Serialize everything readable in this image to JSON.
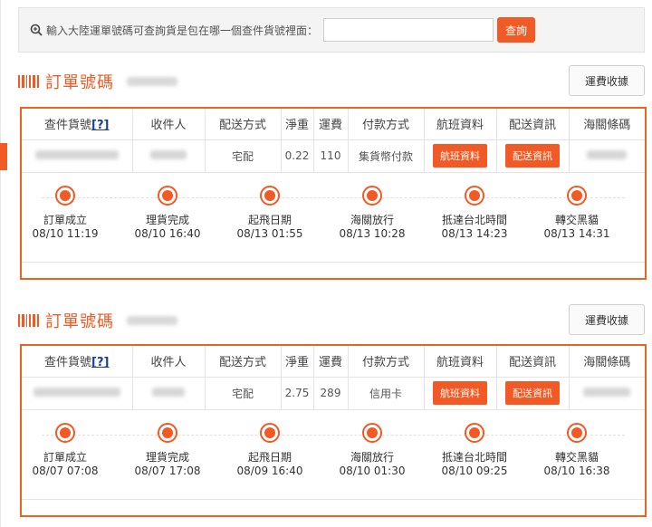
{
  "search": {
    "prompt": "輸入大陸運單號碼可查詢貨是包在哪一個查件貨號裡面：",
    "value": "",
    "placeholder": "",
    "button_label": "查詢"
  },
  "columns": [
    "查件貨號",
    "收件人",
    "配送方式",
    "淨重",
    "運費",
    "付款方式",
    "航班資料",
    "配送資訊",
    "海關條碼"
  ],
  "help_mark": "[?]",
  "orders": [
    {
      "title": "訂單號碼",
      "shipping_button": "運費收據",
      "row": {
        "delivery": "宅配",
        "weight": "0.22",
        "fee": "110",
        "payment": "集貨幣付款",
        "flight_btn": "航班資料",
        "delivery_btn": "配送資訊"
      },
      "timeline": [
        {
          "label": "訂單成立",
          "time": "08/10 11:19"
        },
        {
          "label": "理貨完成",
          "time": "08/10 16:40"
        },
        {
          "label": "起飛日期",
          "time": "08/13 01:55"
        },
        {
          "label": "海關放行",
          "time": "08/13 10:28"
        },
        {
          "label": "抵達台北時間",
          "time": "08/13 14:23"
        },
        {
          "label": "轉交黑貓",
          "time": "08/13 14:31"
        }
      ]
    },
    {
      "title": "訂單號碼",
      "shipping_button": "運費收據",
      "row": {
        "delivery": "宅配",
        "weight": "2.75",
        "fee": "289",
        "payment": "信用卡",
        "flight_btn": "航班資料",
        "delivery_btn": "配送資訊"
      },
      "timeline": [
        {
          "label": "訂單成立",
          "time": "08/07 07:08"
        },
        {
          "label": "理貨完成",
          "time": "08/07 17:08"
        },
        {
          "label": "起飛日期",
          "time": "08/09 16:40"
        },
        {
          "label": "海關放行",
          "time": "08/10 01:30"
        },
        {
          "label": "抵達台北時間",
          "time": "08/10 09:25"
        },
        {
          "label": "轉交黑貓",
          "time": "08/10 16:38"
        }
      ]
    }
  ],
  "colors": {
    "accent": "#f15a24",
    "border": "#e8641f"
  },
  "icons": [
    "search-icon",
    "barcode-icon",
    "status-dot-icon"
  ]
}
